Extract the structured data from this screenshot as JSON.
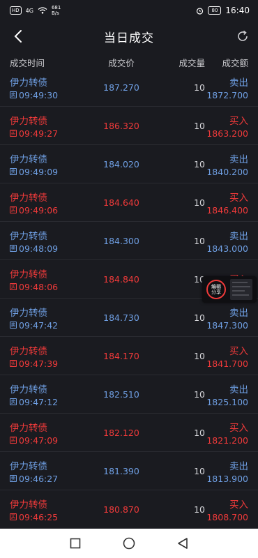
{
  "status_bar": {
    "network_badge": "HD",
    "signal_label": "4G",
    "speed_value": "681",
    "speed_unit": "B/s",
    "battery": "80",
    "time": "16:40"
  },
  "header": {
    "title": "当日成交"
  },
  "columns": {
    "time": "成交时间",
    "price": "成交价",
    "volume": "成交量",
    "amount": "成交额"
  },
  "trades": [
    {
      "name": "伊力转债",
      "tag": "卖",
      "time": "09:49:30",
      "price": "187.270",
      "volume": "10",
      "side": "卖出",
      "amount": "1872.700",
      "color": "#6f9fe3"
    },
    {
      "name": "伊力转债",
      "tag": "买",
      "time": "09:49:27",
      "price": "186.320",
      "volume": "10",
      "side": "买入",
      "amount": "1863.200",
      "color": "#f03a3a"
    },
    {
      "name": "伊力转债",
      "tag": "卖",
      "time": "09:49:09",
      "price": "184.020",
      "volume": "10",
      "side": "卖出",
      "amount": "1840.200",
      "color": "#6f9fe3"
    },
    {
      "name": "伊力转债",
      "tag": "买",
      "time": "09:49:06",
      "price": "184.640",
      "volume": "10",
      "side": "买入",
      "amount": "1846.400",
      "color": "#f03a3a"
    },
    {
      "name": "伊力转债",
      "tag": "卖",
      "time": "09:48:09",
      "price": "184.300",
      "volume": "10",
      "side": "卖出",
      "amount": "1843.000",
      "color": "#6f9fe3"
    },
    {
      "name": "伊力转债",
      "tag": "买",
      "time": "09:48:06",
      "price": "184.840",
      "volume": "10",
      "side": "买入",
      "amount": "",
      "color": "#f03a3a"
    },
    {
      "name": "伊力转债",
      "tag": "卖",
      "time": "09:47:42",
      "price": "184.730",
      "volume": "10",
      "side": "卖出",
      "amount": "1847.300",
      "color": "#6f9fe3"
    },
    {
      "name": "伊力转债",
      "tag": "买",
      "time": "09:47:39",
      "price": "184.170",
      "volume": "10",
      "side": "买入",
      "amount": "1841.700",
      "color": "#f03a3a"
    },
    {
      "name": "伊力转债",
      "tag": "卖",
      "time": "09:47:12",
      "price": "182.510",
      "volume": "10",
      "side": "卖出",
      "amount": "1825.100",
      "color": "#6f9fe3"
    },
    {
      "name": "伊力转债",
      "tag": "买",
      "time": "09:47:09",
      "price": "182.120",
      "volume": "10",
      "side": "买入",
      "amount": "1821.200",
      "color": "#f03a3a"
    },
    {
      "name": "伊力转债",
      "tag": "卖",
      "time": "09:46:27",
      "price": "181.390",
      "volume": "10",
      "side": "卖出",
      "amount": "1813.900",
      "color": "#6f9fe3"
    },
    {
      "name": "伊力转债",
      "tag": "买",
      "time": "09:46:25",
      "price": "180.870",
      "volume": "10",
      "side": "买入",
      "amount": "1808.700",
      "color": "#f03a3a"
    }
  ],
  "float_share": {
    "line1": "编辑",
    "line2": "分享"
  },
  "icons": {
    "back": "chevron-left-icon",
    "refresh": "refresh-icon",
    "nav_recent": "square-icon",
    "nav_home": "circle-icon",
    "nav_back": "triangle-left-icon"
  },
  "colors": {
    "background": "#1a1b20",
    "sell": "#6f9fe3",
    "buy": "#f03a3a"
  }
}
